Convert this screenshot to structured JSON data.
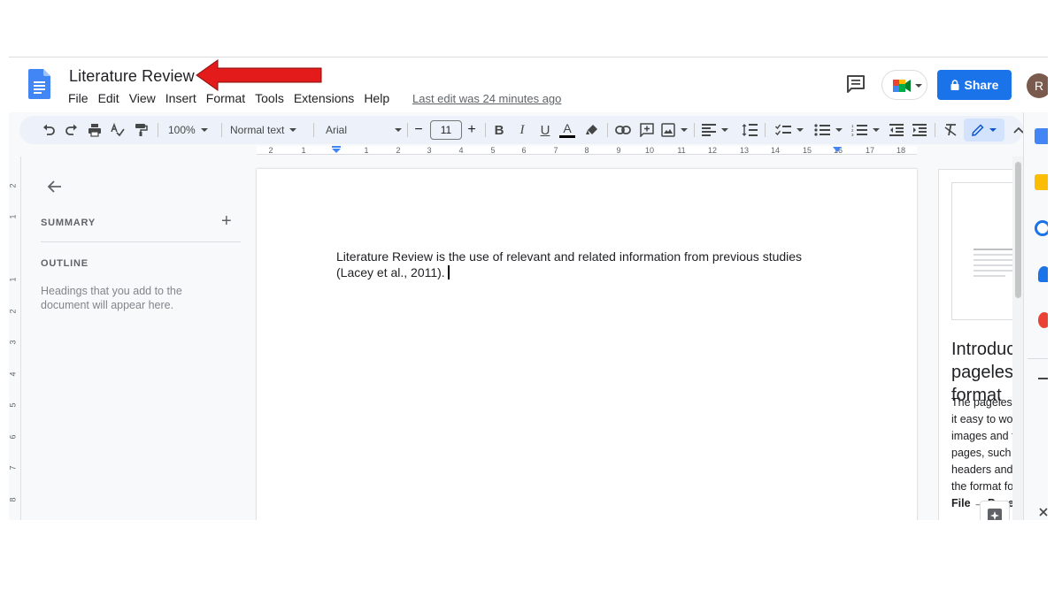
{
  "header": {
    "doc_title": "Literature Review",
    "menu": [
      "File",
      "Edit",
      "View",
      "Insert",
      "Format",
      "Tools",
      "Extensions",
      "Help"
    ],
    "last_edit": "Last edit was 24 minutes ago",
    "share_label": "Share",
    "avatar_initial": "R"
  },
  "toolbar": {
    "zoom": "100%",
    "style": "Normal text",
    "font": "Arial",
    "font_size": "11",
    "decrease_size": "−",
    "increase_size": "+",
    "bold": "B",
    "italic": "I",
    "underline": "U",
    "text_color": "A"
  },
  "ruler": {
    "numbers": [
      "2",
      "1",
      "1",
      "2",
      "3",
      "4",
      "5",
      "6",
      "7",
      "8",
      "9",
      "10",
      "11",
      "12",
      "13",
      "14",
      "15",
      "16",
      "17",
      "18"
    ]
  },
  "vertical_ruler": {
    "numbers": [
      "2",
      "1",
      "1",
      "2",
      "3",
      "4",
      "5",
      "6",
      "7",
      "8"
    ]
  },
  "outline_panel": {
    "summary_label": "SUMMARY",
    "summary_add": "+",
    "outline_label": "OUTLINE",
    "outline_hint": "Headings that you add to the document will appear here."
  },
  "document": {
    "body_text": "Literature Review is the use of relevant and related information from previous studies (Lacey et al., 2011)."
  },
  "info_card": {
    "heading": "Introducing pageless format",
    "body": "The pageless format makes it easy to work with wide images and tables. To use pages, such as page breaks, headers and footers, change the format for a document at",
    "path": "File → Page setup"
  },
  "colors": {
    "accent": "#1a73e8",
    "annotation_arrow": "#e31b1b",
    "toolbar_bg": "#edf2fa",
    "docs_blue": "#4285f4"
  },
  "icons": {
    "header": [
      "docs-logo-icon",
      "comment-icon",
      "meet-icon",
      "lock-icon"
    ],
    "toolbar": [
      "undo-icon",
      "redo-icon",
      "print-icon",
      "spellcheck-icon",
      "paint-format-icon",
      "highlight-icon",
      "link-icon",
      "add-comment-icon",
      "insert-image-icon",
      "align-icon",
      "line-spacing-icon",
      "checklist-icon",
      "bullet-list-icon",
      "numbered-list-icon",
      "decrease-indent-icon",
      "increase-indent-icon",
      "clear-formatting-icon",
      "editing-mode-icon",
      "collapse-menus-icon"
    ]
  }
}
